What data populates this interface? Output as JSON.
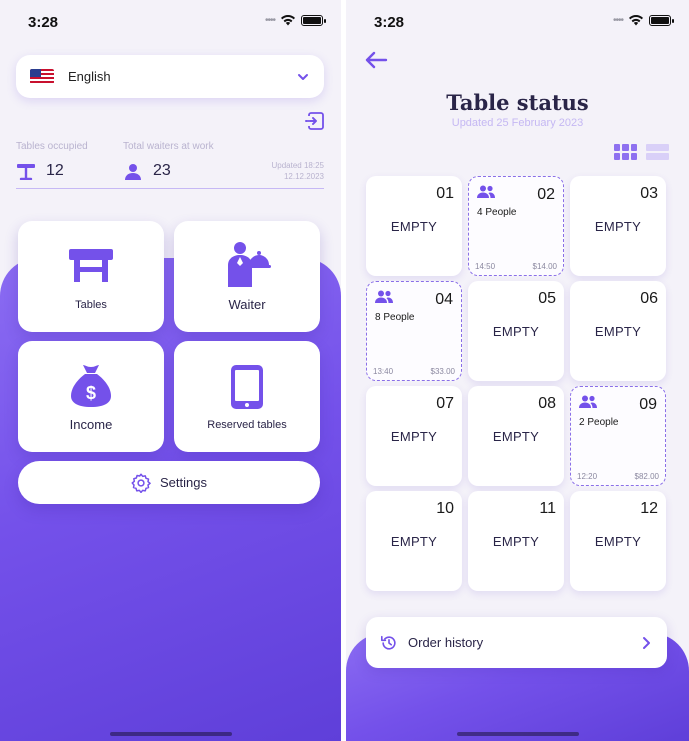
{
  "left_screen": {
    "status_time": "3:28",
    "language": {
      "selected": "English"
    },
    "stats": {
      "tables_occupied_label": "Tables occupied",
      "tables_occupied_value": "12",
      "waiters_label": "Total waiters at work",
      "waiters_value": "23",
      "updated_line1": "Updated 18:25",
      "updated_line2": "12.12.2023"
    },
    "menu": {
      "tables": "Tables",
      "waiter": "Waiter",
      "income": "Income",
      "reserved": "Reserved tables"
    },
    "settings_label": "Settings"
  },
  "right_screen": {
    "status_time": "3:28",
    "title": "Table status",
    "subtitle": "Updated 25 February 2023",
    "tables": [
      {
        "number": "01",
        "status": "EMPTY"
      },
      {
        "number": "02",
        "people": "4 People",
        "time": "14:50",
        "amount": "$14.00"
      },
      {
        "number": "03",
        "status": "EMPTY"
      },
      {
        "number": "04",
        "people": "8 People",
        "time": "13:40",
        "amount": "$33.00"
      },
      {
        "number": "05",
        "status": "EMPTY"
      },
      {
        "number": "06",
        "status": "EMPTY"
      },
      {
        "number": "07",
        "status": "EMPTY"
      },
      {
        "number": "08",
        "status": "EMPTY"
      },
      {
        "number": "09",
        "people": "2 People",
        "time": "12:20",
        "amount": "$82.00"
      },
      {
        "number": "10",
        "status": "EMPTY"
      },
      {
        "number": "11",
        "status": "EMPTY"
      },
      {
        "number": "12",
        "status": "EMPTY"
      }
    ],
    "order_history_label": "Order history"
  },
  "icons": {
    "back": "arrow-left-icon",
    "logout": "logout-icon",
    "grid_view": "grid-view-icon",
    "list_view": "list-view-icon",
    "people": "people-icon",
    "history": "history-icon",
    "settings": "gear-icon"
  },
  "colors": {
    "accent": "#7451ea",
    "accent_light": "#c5b8f3",
    "text_dark": "#2a2548",
    "background": "#f4f2f9"
  }
}
